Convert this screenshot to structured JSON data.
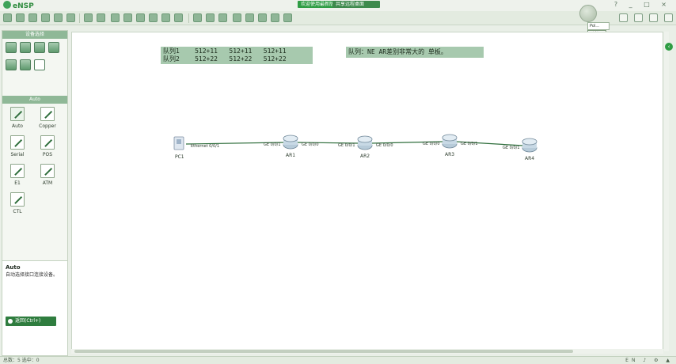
{
  "titlebar": {
    "app_name": "eNSP",
    "welcome_button": "欢迎使用最新版",
    "share_button": "共享远程桌面",
    "window_controls": "? _ □ ×"
  },
  "popup": {
    "tab_label": "Pol...",
    "button_label": "关闭"
  },
  "left_panel": {
    "title": "设备选择",
    "auto_header": "Auto",
    "cables": [
      {
        "label": "Auto"
      },
      {
        "label": "Copper"
      },
      {
        "label": "Serial"
      },
      {
        "label": "POS"
      },
      {
        "label": "E1"
      },
      {
        "label": "ATM"
      },
      {
        "label": "CTL"
      }
    ],
    "description": {
      "title": "Auto",
      "text": "自动选择接口连接设备。",
      "action": "返回(Ctrl+)"
    }
  },
  "canvas": {
    "note1": {
      "row1": "队列1    512+11   512+11   512+11",
      "row2": "队列2    512+22   512+22   512+22"
    },
    "note2": "队列：NE AR差别非常大的 单板。",
    "devices": [
      {
        "name": "PC1"
      },
      {
        "name": "AR1"
      },
      {
        "name": "AR2"
      },
      {
        "name": "AR3"
      },
      {
        "name": "AR4"
      }
    ],
    "links": [
      {
        "from": "PC1",
        "to": "AR1",
        "a_label": "Ethernet 0/0/1",
        "b_label": "GE 0/0/1"
      },
      {
        "from": "AR1",
        "to": "AR2",
        "a_label": "GE 0/0/0",
        "b_label": "GE 0/0/1"
      },
      {
        "from": "AR2",
        "to": "AR3",
        "a_label": "GE 0/0/0",
        "b_label": "GE 0/0/0"
      },
      {
        "from": "AR3",
        "to": "AR4",
        "a_label": "GE 0/0/1",
        "b_label": "GE 0/0/1"
      }
    ]
  },
  "statusbar": {
    "left": "总数：5  选中：0",
    "right": "EN ♪ ⚙ ▲"
  },
  "colors": {
    "accent": "#2f9d44",
    "link": "#2f6e3c",
    "note_bg": "#a7c9ae"
  }
}
